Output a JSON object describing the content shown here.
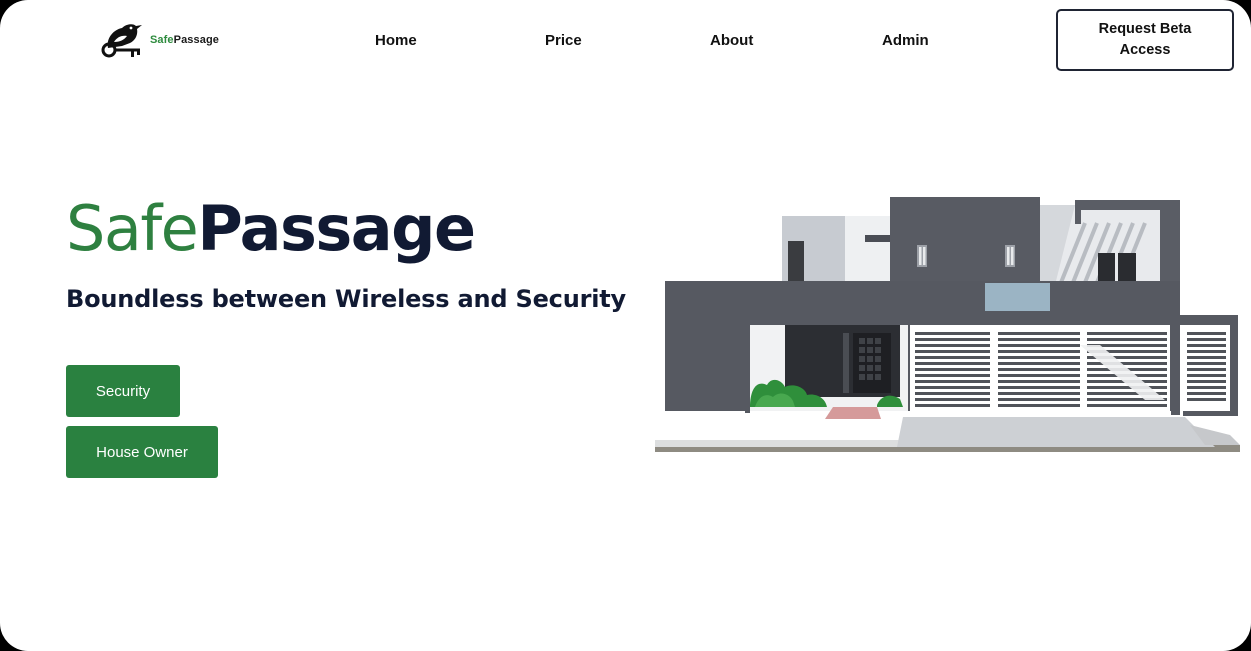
{
  "brand": {
    "logo_part1": "Safe",
    "logo_part2": "Passage",
    "logo_icon": "bird-key-icon"
  },
  "nav": {
    "home": "Home",
    "price": "Price",
    "about": "About",
    "admin": "Admin",
    "cta": "Request Beta Access"
  },
  "hero": {
    "title_part1": "Safe",
    "title_part2": "Passage",
    "subtitle": "Boundless between Wireless and Security",
    "buttons": {
      "security": "Security",
      "house_owner": "House Owner"
    },
    "illustration": "modern-house-illustration"
  },
  "colors": {
    "brand_green": "#2a8140",
    "navy": "#111a33",
    "house_dark": "#565961",
    "house_light": "#d4d6da"
  }
}
